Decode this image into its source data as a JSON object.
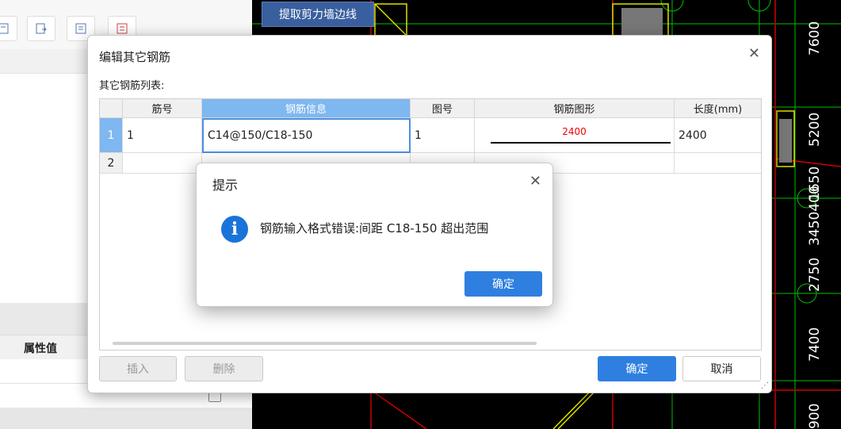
{
  "background": {
    "left_panel": {
      "toolbar_icons": [
        "layout-icon",
        "export-icon",
        "list-icon",
        "grid-icon"
      ],
      "property_header": "属性值"
    },
    "cad": {
      "button_label": "提取剪力墙边线",
      "dimensions": [
        "7600",
        "5200",
        "1650",
        "3450400",
        "2750",
        "7400",
        "900"
      ]
    }
  },
  "dialog": {
    "title": "编辑其它钢筋",
    "list_label": "其它钢筋列表:",
    "columns": [
      "筋号",
      "钢筋信息",
      "图号",
      "钢筋图形",
      "长度(mm)"
    ],
    "rows": [
      {
        "index": "1",
        "bar_no": "1",
        "info": "C14@150/C18-150",
        "figure_no": "1",
        "shape_value": "2400",
        "length": "2400"
      },
      {
        "index": "2",
        "bar_no": "",
        "info": "",
        "figure_no": "",
        "shape_value": "",
        "length": ""
      }
    ],
    "buttons": {
      "insert": "插入",
      "delete": "删除",
      "ok": "确定",
      "cancel": "取消"
    }
  },
  "alert": {
    "title": "提示",
    "message": "钢筋输入格式错误:间距 C18-150 超出范围",
    "ok": "确定"
  },
  "colors": {
    "accent": "#2f7fe0",
    "header_selected": "#7fb7f0",
    "cad_background": "#000000",
    "shape_text": "#e00000"
  }
}
